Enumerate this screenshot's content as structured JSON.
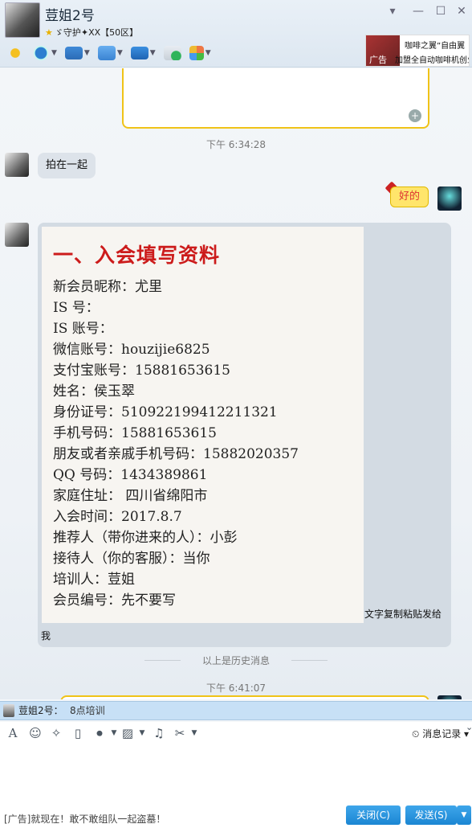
{
  "header": {
    "contact_name": "荳姐2号",
    "signature": "ゞ守护✦XX【50区】",
    "min_icon": "chevron-down-icon",
    "controls": [
      "▾",
      "—",
      "☐",
      "✕"
    ]
  },
  "toolbar": {
    "items": [
      "microphone-icon",
      "video-icon",
      "screen-share-icon",
      "file-transfer-icon",
      "remote-desktop-icon",
      "create-group-icon",
      "apps-icon"
    ]
  },
  "ad_top": {
    "label": "广告",
    "line1": "咖啡之翼”自由翼",
    "line2": "加盟全自动咖啡机创业版"
  },
  "chat": {
    "time1": "下午 6:34:28",
    "msg_left_1": "拍在一起",
    "msg_right_1": "好的",
    "doc": {
      "title": "一、入会填写资料",
      "lines": [
        "新会员昵称：尤里",
        "IS 号：",
        "IS 账号：",
        "微信账号：houzijie6825",
        "支付宝账号：15881653615",
        "姓名：侯玉翠",
        "身份证号：510922199412211321",
        "手机号码：15881653615",
        "朋友或者亲戚手机号码：15882020357",
        "QQ 号码：1434389861",
        "家庭住址： 四川省绵阳市",
        "入会时间：2017.8.7",
        "推荐人（带你进来的人）：小彭",
        "接待人（你的客服）：当你",
        "培训人：荳姐",
        "会员编号：先不要写"
      ]
    },
    "caption": "文字复制粘贴发给",
    "caption2": "我",
    "history_divider": "以上是历史消息",
    "time2": "下午 6:41:07"
  },
  "notify": {
    "sender": "荳姐2号：",
    "message": "8点培训"
  },
  "input_toolbar": {
    "history_label": "消息记录"
  },
  "footer": {
    "ad_text": "[广告]就现在！敢不敢组队一起盗墓！",
    "close_label": "关闭(C)",
    "send_label": "发送(S)"
  },
  "colors": {
    "accent": "#1b86d3",
    "bubble_yellow": "#ffe56b",
    "doc_title_red": "#cc1b1b",
    "card_border": "#f0c318"
  }
}
